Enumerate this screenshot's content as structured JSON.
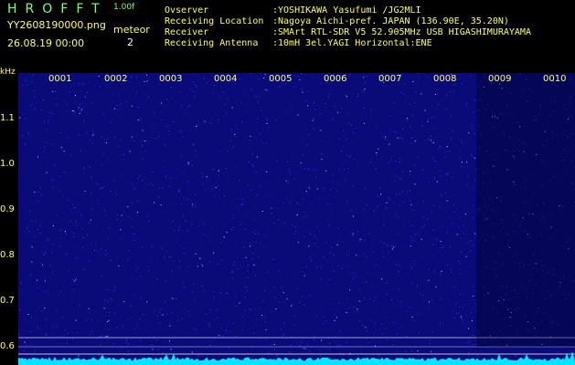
{
  "header": {
    "brand": "HROFFT",
    "version": "1.00f",
    "filename": "YY2608190000.png",
    "datetime": "26.08.19 00:00",
    "meteor_label": "meteor",
    "meteor_count": "2"
  },
  "info": {
    "observer_label": "Ovserver",
    "observer": ":YOSHIKAWA Yasufumi /JG2MLI",
    "location_label": "Receiving Location",
    "location": ":Nagoya Aichi-pref. JAPAN (136.90E, 35.20N)",
    "receiver_label": "Receiver",
    "receiver": ":SMArt RTL-SDR V5 52.905MHz USB HIGASHIMURAYAMA",
    "antenna_label": "Receiving Antenna",
    "antenna": ":10mH 3el.YAGI Horizontal:ENE"
  },
  "spectrogram": {
    "y_unit": "kHz",
    "y_ticks": [
      "1.1",
      "1.0",
      "0.9",
      "0.8",
      "0.7",
      "0.6"
    ],
    "x_ticks": [
      "0001",
      "0002",
      "0003",
      "0004",
      "0005",
      "0006",
      "0007",
      "0008",
      "0009",
      "0010"
    ],
    "colors": {
      "background": "#0a0a78",
      "noise": "#3a3aff",
      "baseline": "#00e5ff",
      "labels": "#ffff66",
      "brand": "#7fff7f"
    }
  }
}
